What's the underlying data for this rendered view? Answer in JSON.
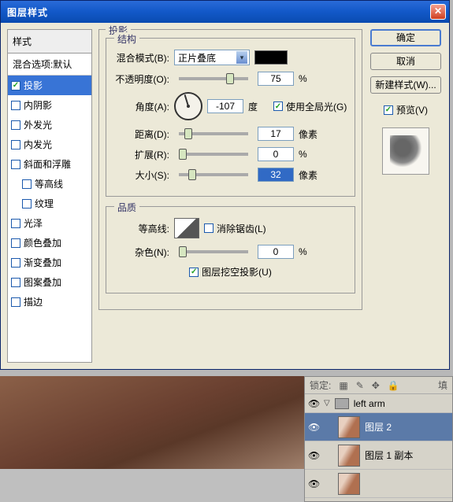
{
  "window": {
    "title": "图层样式"
  },
  "styles": {
    "header": "样式",
    "blend_options": "混合选项:默认",
    "items": [
      {
        "label": "投影",
        "checked": true,
        "active": true,
        "indent": false
      },
      {
        "label": "内阴影",
        "checked": false,
        "indent": false
      },
      {
        "label": "外发光",
        "checked": false,
        "indent": false
      },
      {
        "label": "内发光",
        "checked": false,
        "indent": false
      },
      {
        "label": "斜面和浮雕",
        "checked": false,
        "indent": false
      },
      {
        "label": "等高线",
        "checked": false,
        "indent": true
      },
      {
        "label": "纹理",
        "checked": false,
        "indent": true
      },
      {
        "label": "光泽",
        "checked": false,
        "indent": false
      },
      {
        "label": "颜色叠加",
        "checked": false,
        "indent": false
      },
      {
        "label": "渐变叠加",
        "checked": false,
        "indent": false
      },
      {
        "label": "图案叠加",
        "checked": false,
        "indent": false
      },
      {
        "label": "描边",
        "checked": false,
        "indent": false
      }
    ]
  },
  "main": {
    "group_title": "投影",
    "structure_title": "结构",
    "blend_mode_label": "混合模式(B):",
    "blend_mode_value": "正片叠底",
    "opacity_label": "不透明度(O):",
    "opacity_value": "75",
    "percent": "%",
    "angle_label": "角度(A):",
    "angle_value": "-107",
    "angle_unit": "度",
    "global_light_label": "使用全局光(G)",
    "distance_label": "距离(D):",
    "distance_value": "17",
    "pixels": "像素",
    "spread_label": "扩展(R):",
    "spread_value": "0",
    "size_label": "大小(S):",
    "size_value": "32",
    "quality_title": "品质",
    "contour_label": "等高线:",
    "antialias_label": "消除锯齿(L)",
    "noise_label": "杂色(N):",
    "noise_value": "0",
    "knockout_label": "图层挖空投影(U)"
  },
  "buttons": {
    "ok": "确定",
    "cancel": "取消",
    "new_style": "新建样式(W)...",
    "preview": "预览(V)"
  },
  "layers": {
    "lock_label": "锁定:",
    "fill_label": "填",
    "group": "left arm",
    "layer2": "图层 2",
    "layer1copy": "图层 1 副本"
  }
}
